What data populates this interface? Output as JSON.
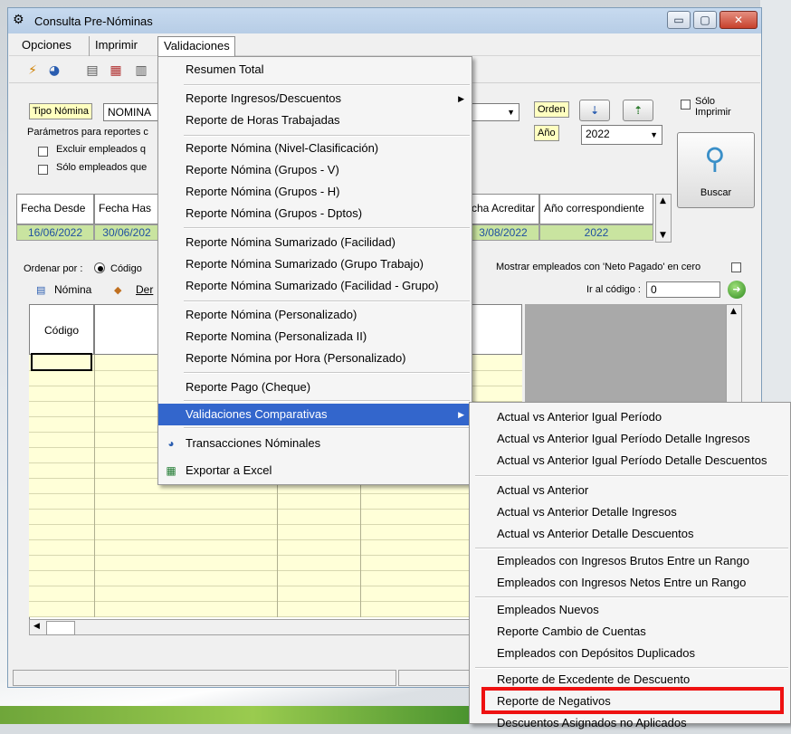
{
  "window": {
    "title": "Consulta Pre-Nóminas",
    "minimize": "▭",
    "maximize": "▢",
    "close": "✕"
  },
  "menubar": {
    "items": [
      "Opciones",
      "Imprimir",
      "Validaciones"
    ]
  },
  "toolbar": {
    "icons": [
      "lightning-icon",
      "chart-icon",
      "printer-icon",
      "calendar-icon",
      "table-icon"
    ]
  },
  "form": {
    "tipo_nomina_label": "Tipo Nómina",
    "tipo_nomina_value": "NOMINA",
    "parametros_label": "Parámetros para reportes c",
    "excluir_label": "Excluir empleados q",
    "solo_label": "Sólo empleados que",
    "orden_label": "Orden",
    "anio_label": "Año",
    "anio_value": "2022",
    "solo_imprimir": "Sólo Imprimir",
    "buscar": "Buscar"
  },
  "period_grid": {
    "headers": [
      "Fecha Desde",
      "Fecha Has",
      "cha Acreditar",
      "Año correspondiente"
    ],
    "row": [
      "16/06/2022",
      "30/06/202",
      "3/08/2022",
      "2022"
    ]
  },
  "lower": {
    "ordenar_label": "Ordenar por :",
    "codigo_radio": "Código",
    "tab_nomina": "Nómina",
    "tab_der": "Der",
    "mostrar_label": "Mostrar empleados con 'Neto Pagado' en cero",
    "ir_codigo_label": "Ir al código :",
    "ir_codigo_value": "0",
    "col_codigo": "Código"
  },
  "validaciones_menu": {
    "items": [
      "Resumen Total",
      "Reporte Ingresos/Descuentos",
      "Reporte de Horas Trabajadas",
      "Reporte Nómina (Nivel-Clasificación)",
      "Reporte Nómina (Grupos - V)",
      "Reporte Nómina (Grupos - H)",
      "Reporte Nómina (Grupos - Dptos)",
      "Reporte Nómina Sumarizado (Facilidad)",
      "Reporte Nómina Sumarizado (Grupo Trabajo)",
      "Reporte Nómina Sumarizado (Facilidad - Grupo)",
      "Reporte Nómina (Personalizado)",
      "Reporte Nomina (Personalizada II)",
      "Reporte Nómina por Hora (Personalizado)",
      "Reporte Pago (Cheque)",
      "Validaciones Comparativas",
      "Transacciones Nóminales",
      "Exportar a Excel"
    ]
  },
  "submenu": {
    "items": [
      "Actual vs Anterior Igual Período",
      "Actual vs Anterior Igual Período Detalle Ingresos",
      "Actual vs Anterior Igual Período Detalle Descuentos",
      "Actual vs Anterior",
      "Actual vs Anterior Detalle Ingresos",
      "Actual vs Anterior Detalle Descuentos",
      "Empleados con Ingresos Brutos Entre un Rango",
      "Empleados con Ingresos Netos Entre un Rango",
      "Empleados Nuevos",
      "Reporte Cambio de Cuentas",
      "Empleados con Depósitos Duplicados",
      "Reporte de Excedente de Descuento",
      "Reporte de Negativos",
      "Descuentos Asignados no Aplicados"
    ]
  },
  "colors": {
    "highlight": "#3366cc",
    "red_box": "#ee1111",
    "grid_green": "#c9e4a0",
    "yellow": "#ffffc0"
  }
}
